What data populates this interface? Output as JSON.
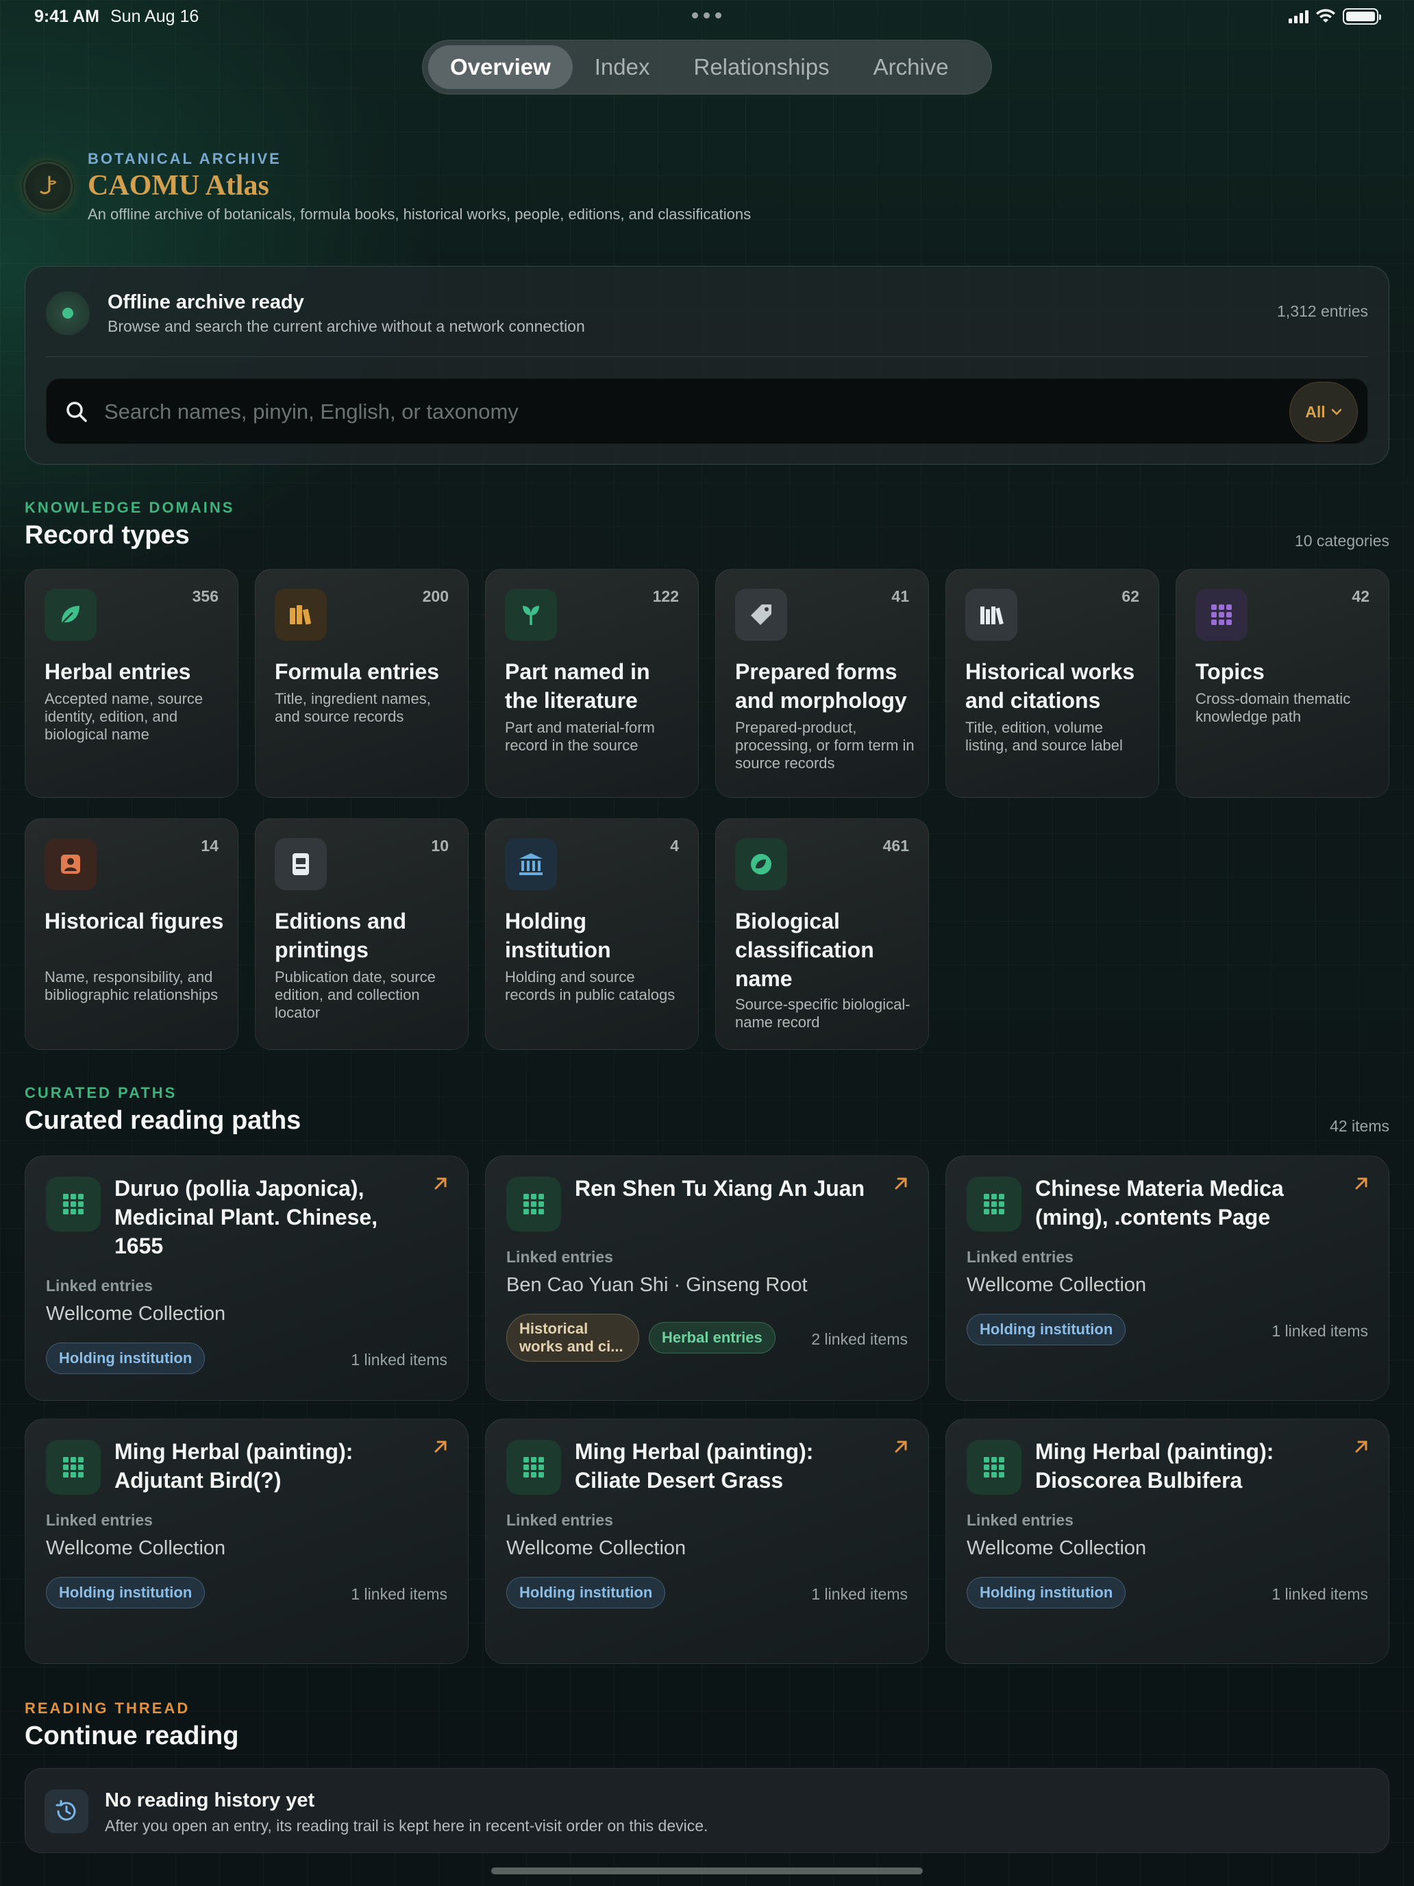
{
  "status_bar": {
    "time": "9:41 AM",
    "date": "Sun Aug 16"
  },
  "tabs": [
    {
      "label": "Overview",
      "active": true
    },
    {
      "label": "Index",
      "active": false
    },
    {
      "label": "Relationships",
      "active": false
    },
    {
      "label": "Archive",
      "active": false
    }
  ],
  "header": {
    "eyebrow": "BOTANICAL ARCHIVE",
    "title": "CAOMU Atlas",
    "subtitle": "An offline archive of botanicals, formula books, historical works, people, editions, and classifications"
  },
  "offline": {
    "title": "Offline archive ready",
    "subtitle": "Browse and search the current archive without a network connection",
    "entries": "1,312 entries",
    "status_color": "#3fc08a"
  },
  "search": {
    "placeholder": "Search names, pinyin, English, or taxonomy",
    "filter": "All"
  },
  "domains": {
    "eyebrow": "KNOWLEDGE DOMAINS",
    "title": "Record types",
    "count": "10 categories",
    "items": [
      {
        "count": "356",
        "title": "Herbal entries",
        "desc": "Accepted name, source identity, edition, and biological name",
        "icon": "leaf-icon",
        "color": "#3fc08a"
      },
      {
        "count": "200",
        "title": "Formula entries",
        "desc": "Title, ingredient names, and source records",
        "icon": "books-icon",
        "color": "#e0a33f"
      },
      {
        "count": "122",
        "title": "Part named in the literature",
        "desc": "Part and material-form record in the source",
        "icon": "sprout-icon",
        "color": "#3fc08a"
      },
      {
        "count": "41",
        "title": "Prepared forms and morphology",
        "desc": "Prepared-product, processing, or form term in source records",
        "icon": "tag-icon",
        "color": "#c4ccd0"
      },
      {
        "count": "62",
        "title": "Historical works and citations",
        "desc": "Title, edition, volume listing, and source label",
        "icon": "library-icon",
        "color": "#e8ecee"
      },
      {
        "count": "42",
        "title": "Topics",
        "desc": "Cross-domain thematic knowledge path",
        "icon": "grid-icon",
        "color": "#9a6ed6"
      },
      {
        "count": "14",
        "title": "Historical figures",
        "desc": "Name, responsibility, and bibliographic relationships",
        "icon": "person-card-icon",
        "color": "#e07a4f"
      },
      {
        "count": "10",
        "title": "Editions and printings",
        "desc": "Publication date, source edition, and collection locator",
        "icon": "document-icon",
        "color": "#e8ecee"
      },
      {
        "count": "4",
        "title": "Holding institution",
        "desc": "Holding and source records in public catalogs",
        "icon": "institution-icon",
        "color": "#6aaee0"
      },
      {
        "count": "461",
        "title": "Biological classification name",
        "desc": "Source-specific biological-name record",
        "icon": "leaf-circle-icon",
        "color": "#3fc08a"
      }
    ]
  },
  "paths": {
    "eyebrow": "CURATED PATHS",
    "title": "Curated reading paths",
    "count": "42 items",
    "linked_label": "Linked entries",
    "items": [
      {
        "title": "Duruo (pollia Japonica), Medicinal Plant. Chinese, 1655",
        "linked": "Wellcome Collection",
        "tags": [
          {
            "label": "Holding institution",
            "style": "blue"
          }
        ],
        "count": "1 linked items"
      },
      {
        "title": "Ren Shen Tu Xiang An Juan",
        "linked": "Ben Cao Yuan Shi · Ginseng Root",
        "tags": [
          {
            "label": "Historical works and ci...",
            "style": "brown"
          },
          {
            "label": "Herbal entries",
            "style": "green"
          }
        ],
        "count": "2 linked items"
      },
      {
        "title": "Chinese Materia Medica (ming), .contents Page",
        "linked": "Wellcome Collection",
        "tags": [
          {
            "label": "Holding institution",
            "style": "blue"
          }
        ],
        "count": "1 linked items"
      },
      {
        "title": "Ming Herbal (painting): Adjutant Bird(?)",
        "linked": "Wellcome Collection",
        "tags": [
          {
            "label": "Holding institution",
            "style": "blue"
          }
        ],
        "count": "1 linked items"
      },
      {
        "title": "Ming Herbal (painting): Ciliate Desert Grass",
        "linked": "Wellcome Collection",
        "tags": [
          {
            "label": "Holding institution",
            "style": "blue"
          }
        ],
        "count": "1 linked items"
      },
      {
        "title": "Ming Herbal (painting): Dioscorea Bulbifera",
        "linked": "Wellcome Collection",
        "tags": [
          {
            "label": "Holding institution",
            "style": "blue"
          }
        ],
        "count": "1 linked items"
      }
    ]
  },
  "reading": {
    "eyebrow": "READING THREAD",
    "title": "Continue reading",
    "empty_title": "No reading history yet",
    "empty_subtitle": "After you open an entry, its reading trail is kept here in recent-visit order on this device."
  },
  "colors": {
    "accent_gold": "#d2a04f",
    "accent_green": "#3fb27e",
    "accent_blue": "#7aa9cf",
    "accent_orange": "#e0923f"
  }
}
